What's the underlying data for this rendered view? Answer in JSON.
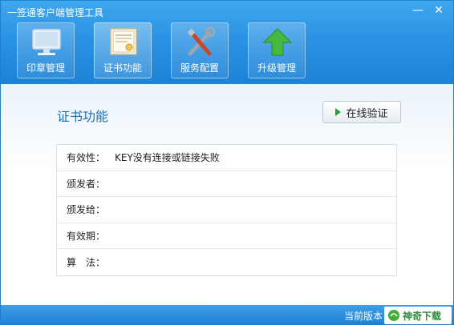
{
  "window": {
    "title": "一签通客户端管理工具",
    "controls": {
      "minimize": "—",
      "close": "✕"
    }
  },
  "toolbar": {
    "items": [
      {
        "label": "印章管理",
        "icon": "monitor-icon"
      },
      {
        "label": "证书功能",
        "icon": "certificate-icon"
      },
      {
        "label": "服务配置",
        "icon": "tools-icon"
      },
      {
        "label": "升级管理",
        "icon": "upgrade-arrow-icon"
      }
    ]
  },
  "main": {
    "section_title": "证书功能",
    "verify_button": "在线验证",
    "fields": [
      {
        "label": "有效性：",
        "value": "KEY没有连接或链接失败"
      },
      {
        "label": "颁发者：",
        "value": ""
      },
      {
        "label": "颁发给：",
        "value": ""
      },
      {
        "label": "有效期：",
        "value": ""
      },
      {
        "label": "算　法：",
        "value": ""
      }
    ]
  },
  "status_bar": {
    "version_label": "当前版本",
    "brand": "神奇下载"
  },
  "colors": {
    "header_blue": "#2a93e4",
    "title_blue": "#1e6fb0",
    "upgrade_green": "#3fae3a"
  }
}
